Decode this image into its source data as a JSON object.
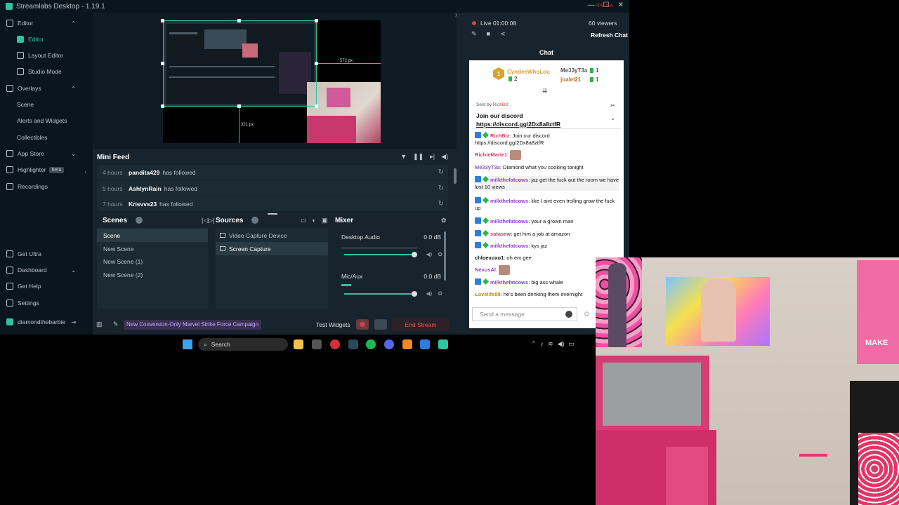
{
  "app": {
    "title": "Streamlabs Desktop - 1.19.1",
    "fps": "FPS: N/A"
  },
  "sidebar": {
    "items": [
      {
        "label": "Editor",
        "chev": "⌃"
      },
      {
        "label": "Editor"
      },
      {
        "label": "Layout Editor"
      },
      {
        "label": "Studio Mode"
      },
      {
        "label": "Overlays",
        "chev": "⌃"
      },
      {
        "label": "Scene"
      },
      {
        "label": "Alerts and Widgets"
      },
      {
        "label": "Collectibles"
      },
      {
        "label": "App Store",
        "chev": "⌄"
      },
      {
        "label": "Highlighter",
        "badge": "beta"
      },
      {
        "label": "Recordings"
      },
      {
        "label": "Get Ultra"
      },
      {
        "label": "Dashboard",
        "chev": "⌄"
      },
      {
        "label": "Get Help"
      },
      {
        "label": "Settings"
      },
      {
        "label": "diamondthebarbie"
      }
    ]
  },
  "preview": {
    "width_label": "572 px",
    "height_label": "321 px"
  },
  "minifeed": {
    "title": "Mini Feed",
    "rows": [
      {
        "age": "4 hours",
        "name": "pandita429",
        "action": "has followed"
      },
      {
        "age": "5 hours",
        "name": "AshlynRain",
        "action": "has followed"
      },
      {
        "age": "7 hours",
        "name": "Krisvvs23",
        "action": "has followed"
      }
    ]
  },
  "scenes": {
    "title": "Scenes",
    "items": [
      "Scene",
      "New Scene",
      "New Scene (1)",
      "New Scene (2)"
    ]
  },
  "sources": {
    "title": "Sources",
    "items": [
      "Video Capture Device",
      "Screen Capture"
    ]
  },
  "mixer": {
    "title": "Mixer",
    "channels": [
      {
        "name": "Desktop Audio",
        "db": "0.0 dB",
        "level": 1.0
      },
      {
        "name": "Mic/Aux",
        "db": "0.0 dB",
        "level": 1.0
      }
    ]
  },
  "footer": {
    "campaign": "New Conversion-Only Marvel Strike Force Campaign",
    "test_widgets": "Test Widgets",
    "end_stream": "End Stream"
  },
  "live": {
    "time": "Live 01:00:08",
    "viewers": "60 viewers",
    "refresh": "Refresh Chat"
  },
  "chat": {
    "title": "Chat",
    "leaderboard": {
      "first": {
        "rank": "1",
        "name": "CyndeeWhoLou",
        "count": "2"
      },
      "others": [
        {
          "name": "Me33yT3a",
          "count": "1"
        },
        {
          "name": "joalel21",
          "count": "1"
        }
      ]
    },
    "pinned": {
      "sent_by": "Sent by",
      "sender": "RichBiz",
      "message": "Join our discord",
      "link": "https://discord.gg/2Dx8a8ztfR"
    },
    "messages": [
      {
        "user": "RichBiz",
        "color": "#e03a6a",
        "text": ": Join our discord",
        "extra": "https://discord.gg/2Dx8a8ztfR"
      },
      {
        "user": "RichieMarie1",
        "color": "#e03a6a",
        "text": ":"
      },
      {
        "user": "Me33yT3a",
        "color": "#8a5ad8",
        "text": ": Diamond what you cooking tonight"
      },
      {
        "user": "milkthefatcows",
        "color": "#9a3ad8",
        "text": ": jaz get the fuck out the room we have lost 10 views"
      },
      {
        "user": "milkthefatcows",
        "color": "#9a3ad8",
        "text": ": like I aint even trolling grow the fuck up"
      },
      {
        "user": "milkthefatcows",
        "color": "#9a3ad8",
        "text": ": your a grown man"
      },
      {
        "user": "satasew",
        "color": "#e03a6a",
        "text": ": get him a job at amazon"
      },
      {
        "user": "milkthefatcows",
        "color": "#9a3ad8",
        "text": ": kys jaz"
      },
      {
        "user": "chloexoxo1",
        "color": "#111111",
        "text": ": oh em gee"
      },
      {
        "user": "NexusAl",
        "color": "#9a3ad8",
        "text": ":"
      },
      {
        "user": "milkthefatcows",
        "color": "#9a3ad8",
        "text": ": big ass whale"
      },
      {
        "user": "Lovelife89",
        "color": "#c08a1a",
        "text": ": he's been drinking them overnight"
      }
    ],
    "input_placeholder": "Send a message"
  },
  "taskbar": {
    "search": "Search"
  },
  "webcam": {
    "flag_text": "MAKE"
  }
}
